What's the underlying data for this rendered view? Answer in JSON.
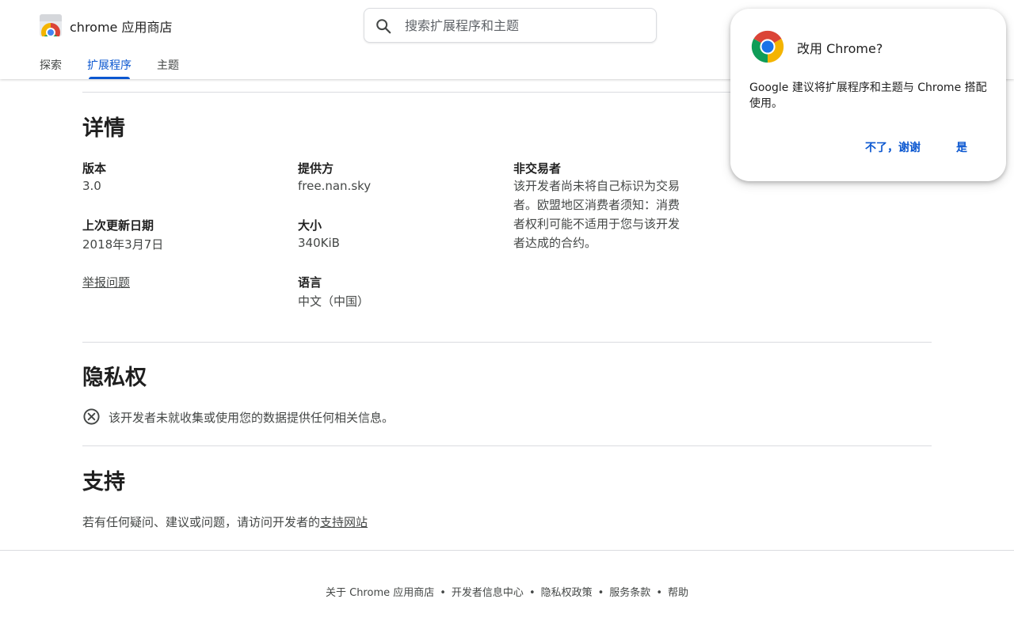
{
  "header": {
    "app_title": "chrome 应用商店",
    "logo_icon": "chrome-web-store-logo-icon",
    "search": {
      "placeholder": "搜索扩展程序和主题",
      "value": "",
      "icon": "search-icon"
    },
    "tabs": [
      {
        "label": "探索",
        "active": false
      },
      {
        "label": "扩展程序",
        "active": true
      },
      {
        "label": "主题",
        "active": false
      }
    ]
  },
  "details": {
    "title": "详情",
    "version": {
      "label": "版本",
      "value": "3.0"
    },
    "updated": {
      "label": "上次更新日期",
      "value": "2018年3月7日"
    },
    "report_link": "举报问题",
    "provider": {
      "label": "提供方",
      "value": "free.nan.sky"
    },
    "size": {
      "label": "大小",
      "value": "340KiB"
    },
    "language": {
      "label": "语言",
      "value": "中文（中国）"
    },
    "non_trader": {
      "label": "非交易者",
      "lines": [
        "该开发者尚未将自己标识为交易",
        "者。欧盟地区消费者须知：消费",
        "者权利可能不适用于您与该开发",
        "者达成的合约。"
      ]
    }
  },
  "privacy": {
    "title": "隐私权",
    "icon": "cancel-circle-icon",
    "text": "该开发者未就收集或使用您的数据提供任何相关信息。"
  },
  "support": {
    "title": "支持",
    "text": "若有任何疑问、建议或问题，请访问开发者的",
    "link": "支持网站"
  },
  "footer": {
    "links": [
      "关于 Chrome 应用商店",
      "开发者信息中心",
      "隐私权政策",
      "服务条款",
      "帮助"
    ],
    "separator": "•"
  },
  "popup": {
    "icon": "chrome-icon",
    "title": "改用 Chrome?",
    "body_line1": "Google 建议将扩展程序和主题与 Chrome 搭配",
    "body_line2": "使用。",
    "decline": "不了，谢谢",
    "accept": "是"
  },
  "colors": {
    "accent": "#0b57d0",
    "text": "#1f1f1f",
    "muted": "#444746",
    "divider": "#dadce0"
  }
}
